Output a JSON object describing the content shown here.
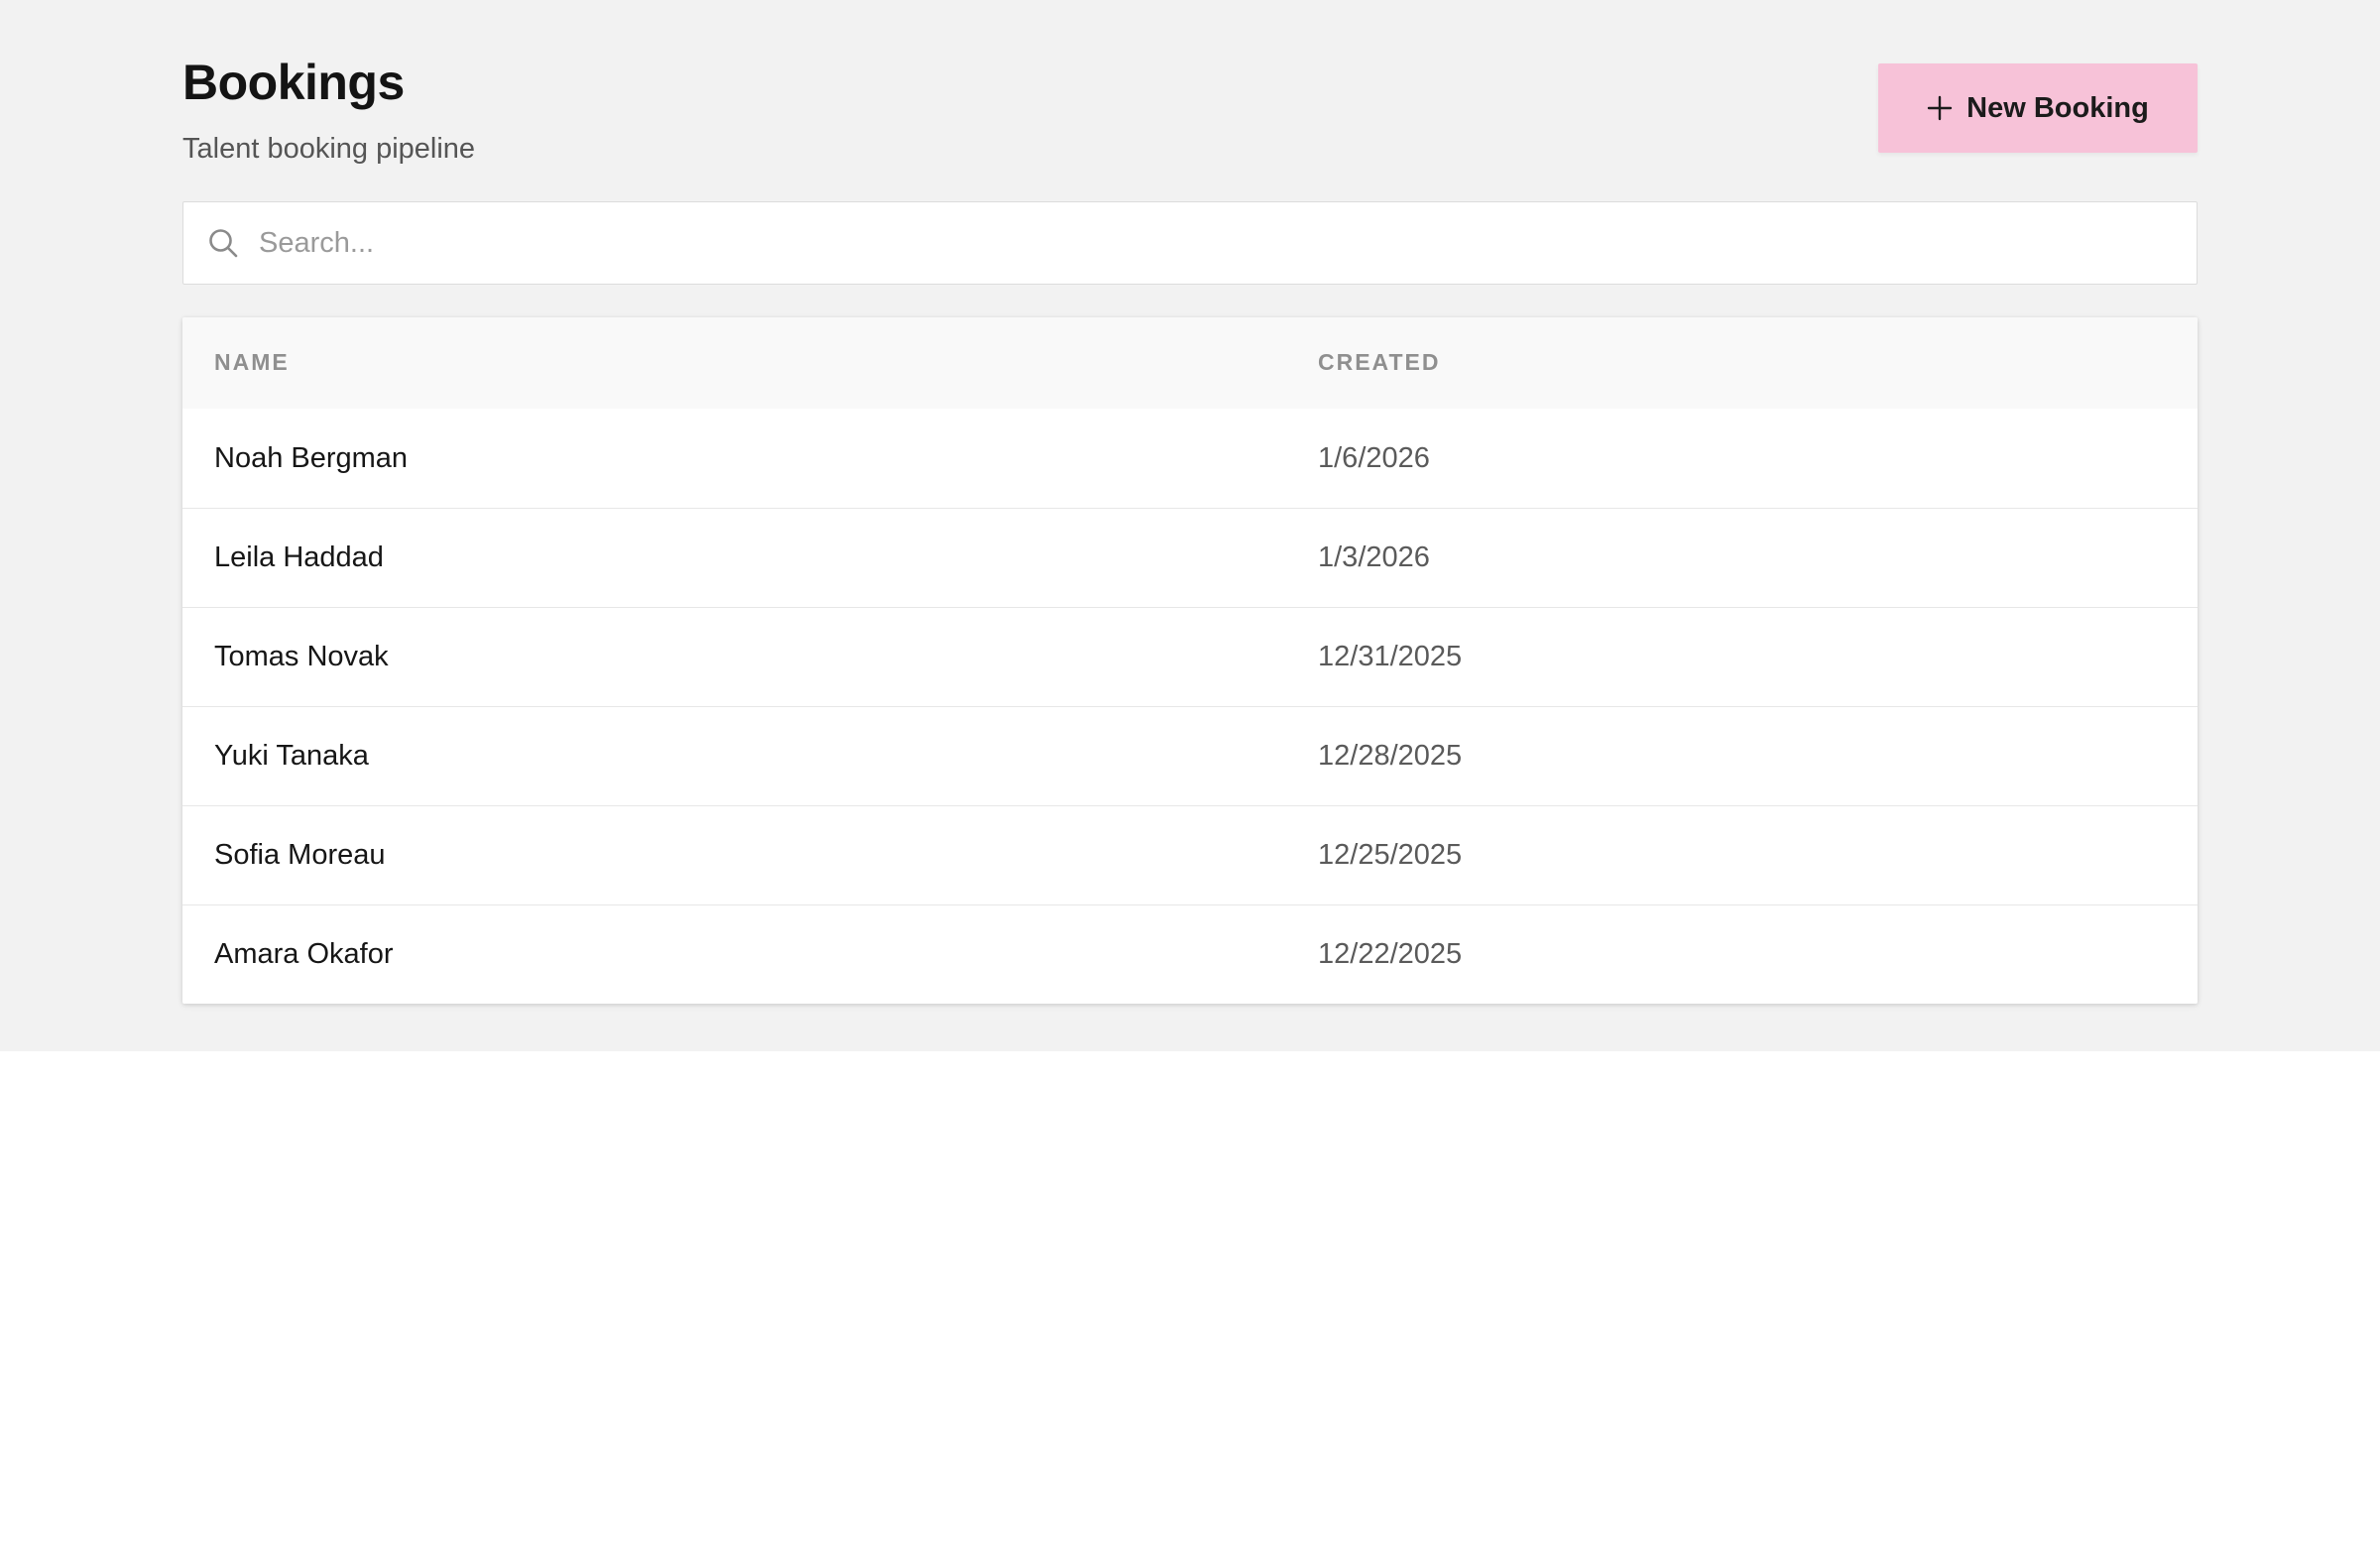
{
  "header": {
    "title": "Bookings",
    "subtitle": "Talent booking pipeline",
    "new_button_label": "New Booking"
  },
  "search": {
    "placeholder": "Search...",
    "value": ""
  },
  "table": {
    "columns": [
      "NAME",
      "CREATED"
    ],
    "rows": [
      {
        "name": "Noah Bergman",
        "created": "1/6/2026"
      },
      {
        "name": "Leila Haddad",
        "created": "1/3/2026"
      },
      {
        "name": "Tomas Novak",
        "created": "12/31/2025"
      },
      {
        "name": "Yuki Tanaka",
        "created": "12/28/2025"
      },
      {
        "name": "Sofia Moreau",
        "created": "12/25/2025"
      },
      {
        "name": "Amara Okafor",
        "created": "12/22/2025"
      }
    ]
  },
  "icons": {
    "search": "search-icon",
    "plus": "plus-icon"
  },
  "colors": {
    "accent_button": "#f7c2d8",
    "page_background": "#f2f2f2"
  }
}
